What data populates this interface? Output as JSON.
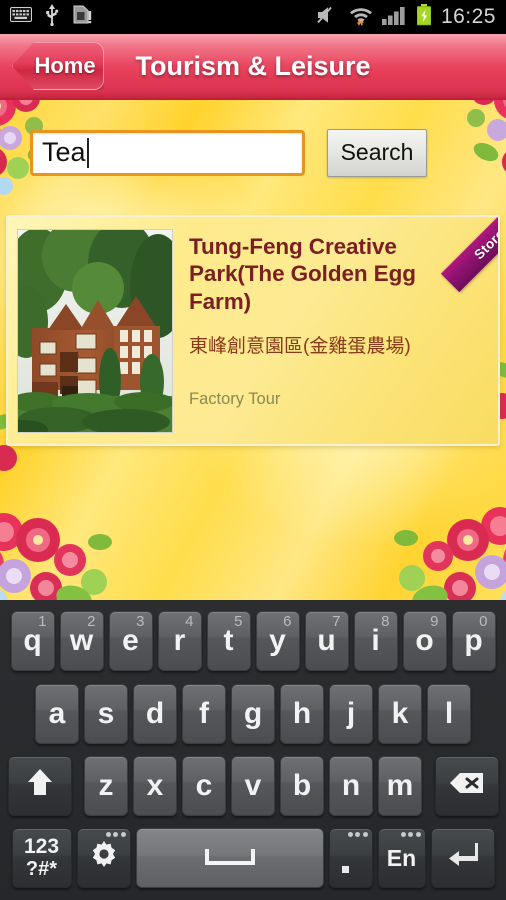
{
  "statusbar": {
    "time": "16:25",
    "icons": [
      "keyboard-icon",
      "usb-icon",
      "sdcard-warning-icon",
      "volume-muted-icon",
      "wifi-icon",
      "signal-bars-icon",
      "battery-charging-icon"
    ]
  },
  "header": {
    "back_label": "Home",
    "title": "Tourism & Leisure",
    "accent_color": "#e8415c"
  },
  "search": {
    "value": "Tea",
    "placeholder": "",
    "button_label": "Search",
    "border_color": "#e8941f"
  },
  "results": [
    {
      "title": "Tung-Feng Creative Park(The Golden Egg Farm)",
      "subtitle": "東峰創意園區(金雞蛋農場)",
      "category": "Factory Tour",
      "badge": "Store",
      "badge_color": "#8e1370",
      "thumb_alt": "wooden-lodge-photo"
    }
  ],
  "keyboard": {
    "row1": [
      {
        "key": "q",
        "num": "1"
      },
      {
        "key": "w",
        "num": "2"
      },
      {
        "key": "e",
        "num": "3"
      },
      {
        "key": "r",
        "num": "4"
      },
      {
        "key": "t",
        "num": "5"
      },
      {
        "key": "y",
        "num": "6"
      },
      {
        "key": "u",
        "num": "7"
      },
      {
        "key": "i",
        "num": "8"
      },
      {
        "key": "o",
        "num": "9"
      },
      {
        "key": "p",
        "num": "0"
      }
    ],
    "row2": [
      "a",
      "s",
      "d",
      "f",
      "g",
      "h",
      "j",
      "k",
      "l"
    ],
    "row3": [
      "z",
      "x",
      "c",
      "v",
      "b",
      "n",
      "m"
    ],
    "shift": "shift-icon",
    "backspace": "backspace-icon",
    "symbols_line1": "123",
    "symbols_line2": "?#*",
    "settings": "gear-icon",
    "space": "space-icon",
    "period": ".",
    "language": "En",
    "enter": "enter-icon"
  }
}
